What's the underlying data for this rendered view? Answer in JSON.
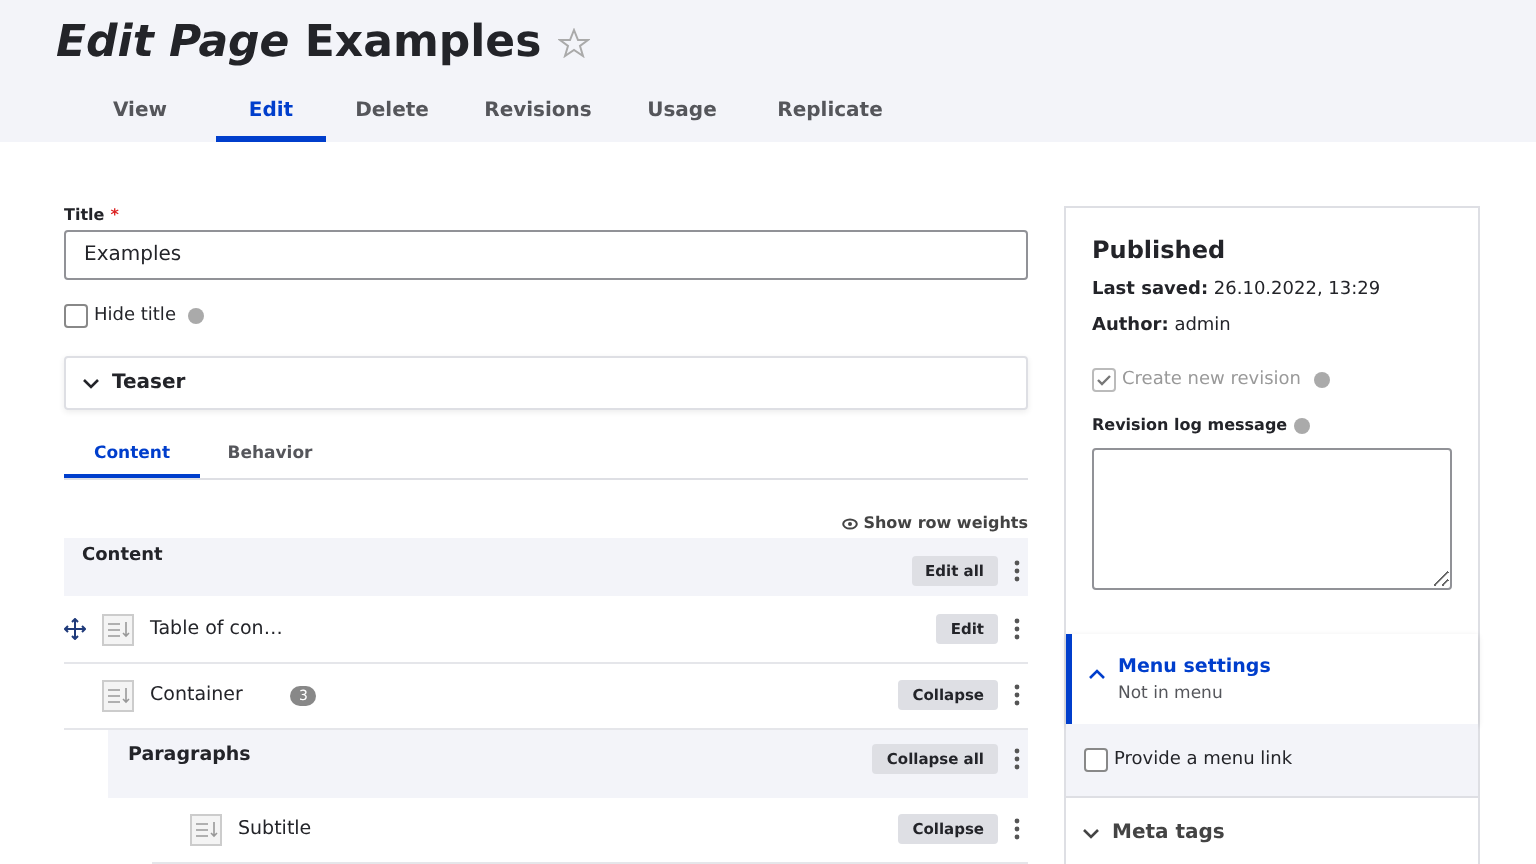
{
  "page_title": {
    "prefix": "Edit Page",
    "name": "Examples"
  },
  "tabs": [
    {
      "label": "View",
      "selected": false
    },
    {
      "label": "Edit",
      "selected": true
    },
    {
      "label": "Delete",
      "selected": false
    },
    {
      "label": "Revisions",
      "selected": false
    },
    {
      "label": "Usage",
      "selected": false
    },
    {
      "label": "Replicate",
      "selected": false
    }
  ],
  "title_field": {
    "label": "Title",
    "required_mark": "*",
    "value": "Examples"
  },
  "hide_title": {
    "label": "Hide title",
    "checked": false
  },
  "teaser": {
    "label": "Teaser",
    "expanded": false
  },
  "content_tabs": [
    {
      "label": "Content",
      "selected": true
    },
    {
      "label": "Behavior",
      "selected": false
    }
  ],
  "show_row_weights": "Show row weights",
  "content_header": {
    "title": "Content",
    "button": "Edit all"
  },
  "rows": [
    {
      "kind": "item",
      "label": "Table of con…",
      "button": "Edit",
      "draggable": true
    },
    {
      "kind": "item",
      "label": "Container",
      "count": "3",
      "button": "Collapse",
      "draggable": false
    },
    {
      "kind": "group",
      "label": "Paragraphs",
      "button": "Collapse all"
    },
    {
      "kind": "subitem",
      "label": "Subtitle",
      "button": "Collapse"
    }
  ],
  "sidebar": {
    "status": "Published",
    "last_saved_label": "Last saved:",
    "last_saved": "26.10.2022, 13:29",
    "author_label": "Author:",
    "author": "admin",
    "new_revision": {
      "label": "Create new revision",
      "checked": true,
      "disabled": true
    },
    "log_label": "Revision log message",
    "menu_settings": {
      "title": "Menu settings",
      "summary": "Not in menu",
      "expanded": true
    },
    "menu_link": {
      "label": "Provide a menu link",
      "checked": false
    },
    "meta_tags": {
      "label": "Meta tags",
      "expanded": false
    }
  }
}
